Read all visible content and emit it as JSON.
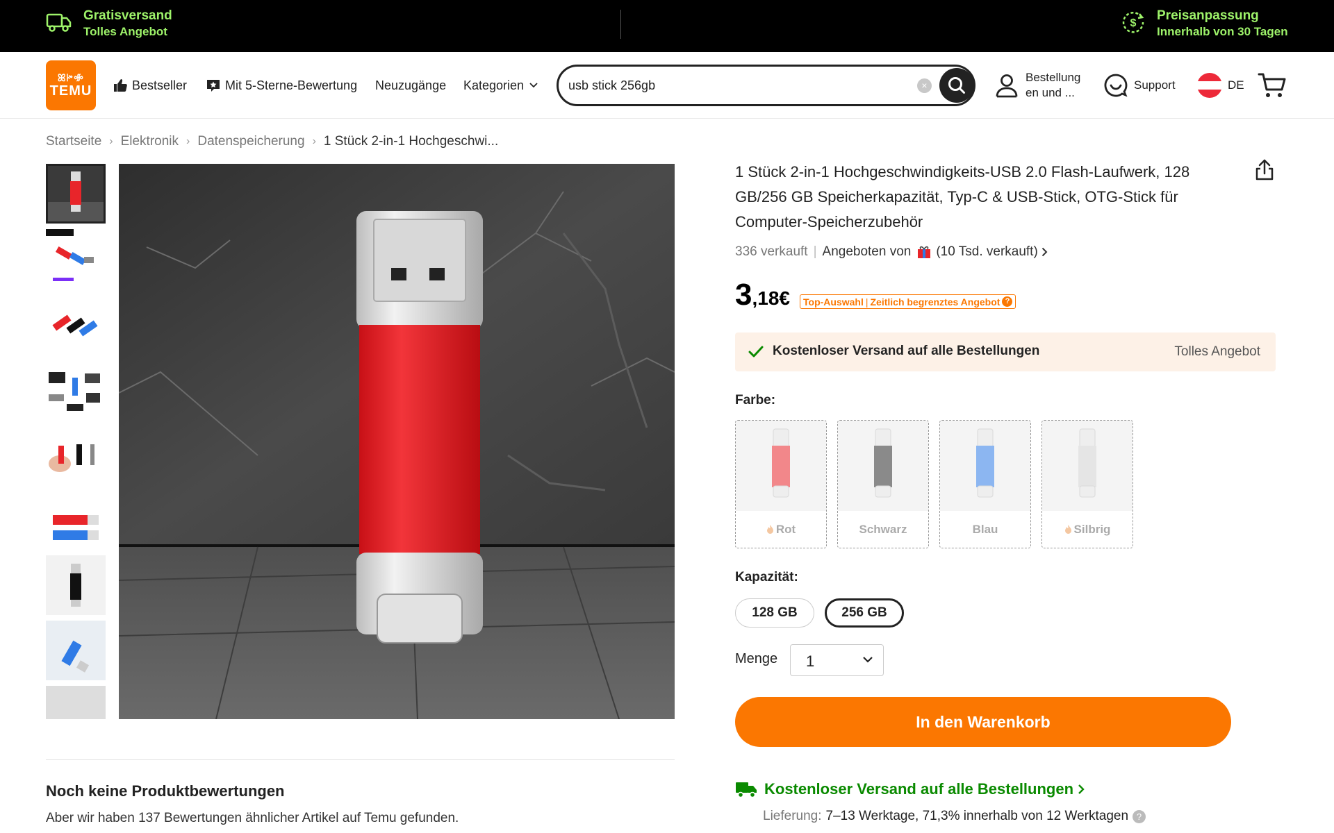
{
  "promo_bar": {
    "left_title": "Gratisversand",
    "left_sub": "Tolles Angebot",
    "right_title": "Preisanpassung",
    "right_sub": "Innerhalb von 30 Tagen"
  },
  "header": {
    "logo_glyphs": "ꕤꔶꗂ",
    "logo_word": "TEMU",
    "nav": {
      "bestseller": "Bestseller",
      "five_star": "Mit 5-Sterne-Bewertung",
      "new": "Neuzugänge",
      "categories": "Kategorien"
    },
    "search": {
      "value": "usb stick 256gb",
      "placeholder": ""
    },
    "orders_line1": "Bestellung",
    "orders_line2": "en und ...",
    "support": "Support",
    "lang": "DE"
  },
  "breadcrumb": [
    "Startseite",
    "Elektronik",
    "Datenspeicherung",
    "1 Stück 2-in-1 Hochgeschwi..."
  ],
  "product": {
    "title": "1 Stück 2-in-1 Hochgeschwindigkeits-USB 2.0 Flash-Laufwerk, 128 GB/256 GB Speicherkapazität, Typ-C & USB-Stick, OTG-Stick für Computer-Speicherzubehör",
    "sold": "336 verkauft",
    "offered_by": "Angeboten von",
    "seller_sold": "(10 Tsd. verkauft)",
    "price_int": "3",
    "price_dec": ",18€",
    "tag1": "Top-Auswahl",
    "tag2": "Zeitlich begrenztes Angebot",
    "shipping_banner": "Kostenloser Versand auf alle Bestellungen",
    "shipping_banner_right": "Tolles Angebot",
    "color_label": "Farbe:",
    "colors": [
      {
        "name": "Rot",
        "body": "#e8252a",
        "flame": true
      },
      {
        "name": "Schwarz",
        "body": "#2b2b2b",
        "flame": false
      },
      {
        "name": "Blau",
        "body": "#2f7be6",
        "flame": false
      },
      {
        "name": "Silbrig",
        "body": "#cfcfcf",
        "flame": true
      }
    ],
    "capacity_label": "Kapazität:",
    "capacities": [
      "128 GB",
      "256 GB"
    ],
    "selected_capacity": "256 GB",
    "qty_label": "Menge",
    "qty_value": "1",
    "add_to_cart": "In den Warenkorb",
    "free_shipping_link": "Kostenloser Versand auf alle Bestellungen",
    "delivery_key": "Lieferung:",
    "delivery_value": "7–13 Werktage, 71,3% innerhalb von 12 Werktagen"
  },
  "reviews": {
    "title": "Noch keine Produktbewertungen",
    "subtitle": "Aber wir haben 137 Bewertungen ähnlicher Artikel auf Temu gefunden."
  },
  "colors": {
    "accent": "#fb7701",
    "promo_green": "#9ef36a",
    "ship_green": "#0a8a00",
    "banner_bg": "#fdf1e7"
  }
}
